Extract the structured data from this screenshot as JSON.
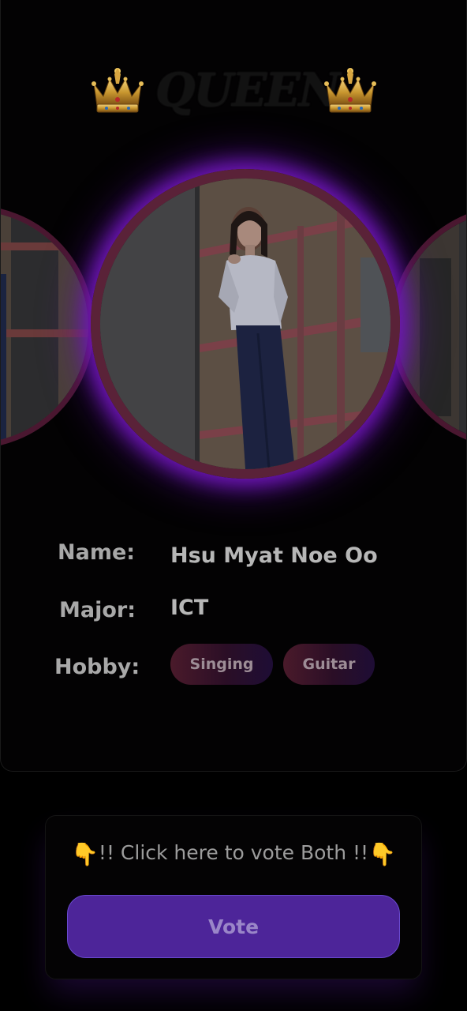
{
  "header": {
    "title": "QUEEN",
    "left_icon": "crown-icon",
    "right_icon": "crown-icon"
  },
  "carousel": {
    "current_index": 1,
    "photos": [
      "previous-candidate-photo",
      "current-candidate-photo",
      "next-candidate-photo"
    ],
    "glow_color": "#6f16b8",
    "ring_color": "#5a2238"
  },
  "profile": {
    "name_label": "Name:",
    "name_value": "Hsu Myat Noe Oo",
    "major_label": "Major:",
    "major_value": "ICT",
    "hobby_label": "Hobby:",
    "hobbies": [
      "Singing",
      "Guitar"
    ]
  },
  "vote": {
    "prompt_text": "!! Click here to vote Both !!",
    "prompt_icon": "pointing-down-hand-icon",
    "hand_glyph": "👇",
    "button_label": "Vote",
    "button_color": "#4d2599"
  }
}
